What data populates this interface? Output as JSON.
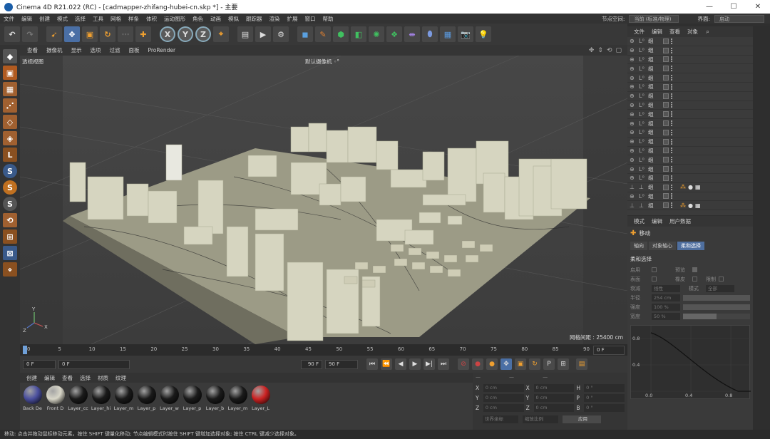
{
  "window": {
    "title": "Cinema 4D R21.022 (RC) - [cadmapper-zhifang-hubei-cn.skp *] - 主要",
    "minimize": "—",
    "maximize": "☐",
    "close": "✕"
  },
  "menubar": {
    "items": [
      "文件",
      "编辑",
      "创建",
      "模式",
      "选择",
      "工具",
      "网格",
      "样条",
      "体积",
      "运动图形",
      "角色",
      "动画",
      "模拟",
      "跟踪器",
      "渲染",
      "扩展",
      "窗口",
      "帮助"
    ],
    "node_space_label": "节点空间:",
    "node_space_value": "当前 (标准/物理)",
    "layout_label": "界面:",
    "layout_value": "启动"
  },
  "viewport": {
    "menu": [
      "查看",
      "摄像机",
      "显示",
      "选项",
      "过滤",
      "面板",
      "ProRender"
    ],
    "view_name": "透视视图",
    "camera": "默认摄像机 ◦°",
    "grid_spacing": "网格间距 : 25400 cm"
  },
  "timeline": {
    "ticks": [
      "0",
      "5",
      "10",
      "15",
      "20",
      "25",
      "30",
      "35",
      "40",
      "45",
      "50",
      "55",
      "60",
      "65",
      "70",
      "75",
      "80",
      "85",
      "90"
    ],
    "current_frame": "0 F",
    "start_field": "0 F",
    "min_field": "0 F",
    "max_field": "90 F",
    "end_field": "90 F"
  },
  "materials": {
    "menu": [
      "创建",
      "编辑",
      "查看",
      "选择",
      "材质",
      "纹理"
    ],
    "items": [
      {
        "label": "Back De",
        "color": "#4a4f9e"
      },
      {
        "label": "Front D",
        "color": "#d8d6c8"
      },
      {
        "label": "Layer_cc",
        "color": "#1a1a1a"
      },
      {
        "label": "Layer_hi",
        "color": "#1a1a1a"
      },
      {
        "label": "Layer_m",
        "color": "#1a1a1a"
      },
      {
        "label": "Layer_p",
        "color": "#1a1a1a"
      },
      {
        "label": "Layer_w",
        "color": "#1a1a1a"
      },
      {
        "label": "Layer_p",
        "color": "#1a1a1a"
      },
      {
        "label": "Layer_b",
        "color": "#1a1a1a"
      },
      {
        "label": "Layer_m",
        "color": "#1a1a1a"
      },
      {
        "label": "Layer_L",
        "color": "#cc2222"
      }
    ]
  },
  "coordinates": {
    "rows": [
      {
        "a": "X",
        "av": "0 cm",
        "b": "X",
        "bv": "0 cm",
        "c": "H",
        "cv": "0 °"
      },
      {
        "a": "Y",
        "av": "0 cm",
        "b": "Y",
        "bv": "0 cm",
        "c": "P",
        "cv": "0 °"
      },
      {
        "a": "Z",
        "av": "0 cm",
        "b": "Z",
        "bv": "0 cm",
        "c": "B",
        "cv": "0 °"
      }
    ],
    "mode": "世界坐标",
    "scale_mode": "缩放比例",
    "apply": "应用"
  },
  "object_manager": {
    "menu": [
      "文件",
      "编辑",
      "查看",
      "对象"
    ],
    "row_label": "组"
  },
  "attribute_manager": {
    "menu": [
      "模式",
      "编辑",
      "用户数据"
    ],
    "title": "移动",
    "tabs": [
      "轴向",
      "对象轴心",
      "柔和选择"
    ],
    "section": "柔和选择",
    "enable": "启用",
    "preview": "预览",
    "surface": "表面",
    "rubber": "橡皮",
    "restrict": "限制",
    "mode_label": "衰减",
    "mode_value": "线性",
    "shape_label": "模式",
    "shape_value": "全部",
    "radius_label": "半径",
    "radius_value": "254 cm",
    "strength_label": "强度",
    "strength_value": "100 %",
    "width_label": "宽度",
    "width_value": "50 %",
    "graph_y": [
      "0.8",
      "0.4"
    ],
    "graph_x": [
      "0.0",
      "0.4",
      "0.8"
    ]
  },
  "status": {
    "text": "移动: 点击并拖动鼠标移动元素。按住 SHIFT 键量化移动; 节点编辑模式时按住 SHIFT 键增加选择对象; 按住 CTRL 键减少选择对象。"
  }
}
